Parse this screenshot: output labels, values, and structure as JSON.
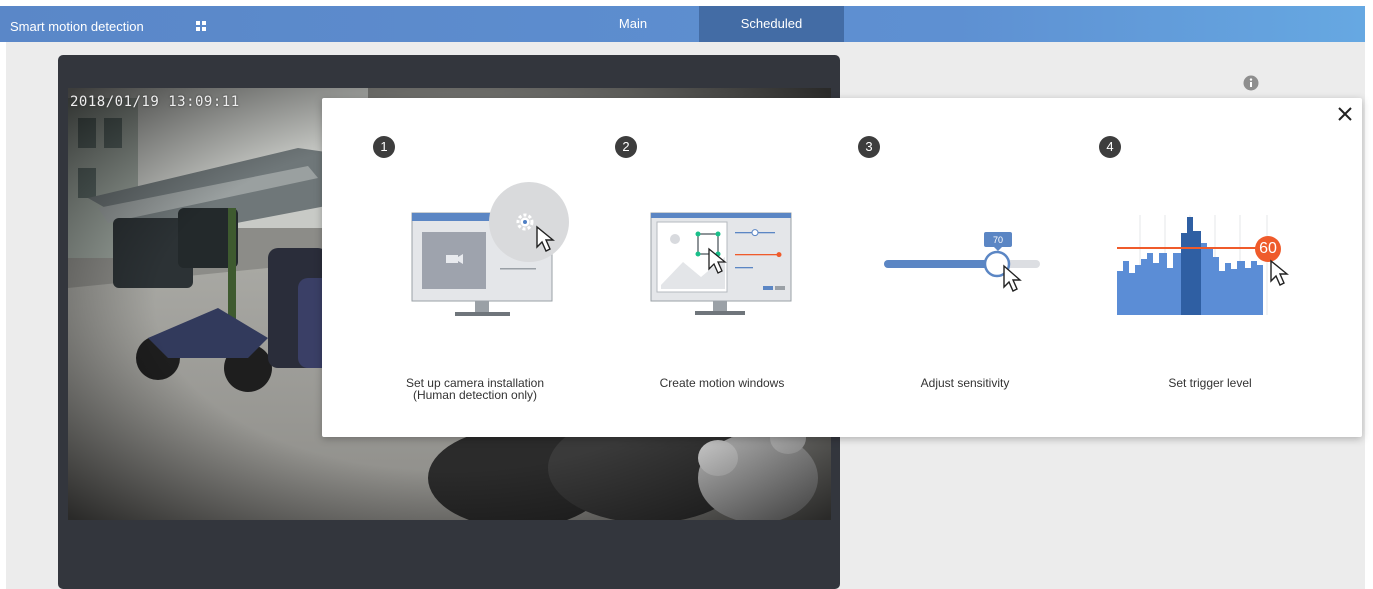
{
  "header": {
    "app_title": "Smart motion detection",
    "tabs": [
      {
        "label": "Main",
        "active": false
      },
      {
        "label": "Scheduled",
        "active": true
      }
    ]
  },
  "video": {
    "timestamp": "2018/01/19 13:09:11"
  },
  "wizard": {
    "steps": [
      {
        "number": "1",
        "label": "Set up camera installation\n(Human detection only)"
      },
      {
        "number": "2",
        "label": "Create motion windows"
      },
      {
        "number": "3",
        "label": "Adjust sensitivity",
        "slider_value": "70"
      },
      {
        "number": "4",
        "label": "Set trigger level",
        "trigger_value": "60"
      }
    ]
  },
  "colors": {
    "header_blue": "#5a87c8",
    "tab_active": "#436ca5",
    "accent_orange": "#ef5b2b",
    "chart_blue": "#5b8dd6",
    "chart_dark": "#2f5fa3"
  },
  "icons": [
    "grid-icon",
    "info-icon",
    "close-icon",
    "gear-icon",
    "cursor-icon",
    "camera-icon"
  ]
}
